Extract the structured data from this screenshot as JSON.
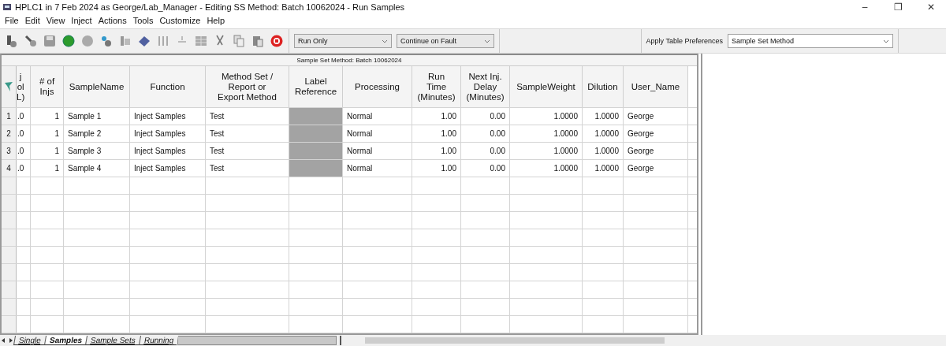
{
  "window": {
    "title": "HPLC1 in 7 Feb 2024 as George/Lab_Manager - Editing SS Method: Batch 10062024 - Run Samples",
    "controls": [
      "–",
      "❐",
      "✕"
    ]
  },
  "menu": [
    "File",
    "Edit",
    "View",
    "Inject",
    "Actions",
    "Tools",
    "Customize",
    "Help"
  ],
  "toolbar": {
    "run_mode": "Run Only",
    "fault_mode": "Continue on Fault",
    "preferences_label": "Apply Table Preferences",
    "preferences_value": "Sample Set Method"
  },
  "table": {
    "caption": "Sample Set Method: Batch 10062024",
    "columns": [
      {
        "label": "j\nol\nL)",
        "kind": "text"
      },
      {
        "label": "# of\nInjs",
        "kind": "number"
      },
      {
        "label": "SampleName",
        "kind": "text"
      },
      {
        "label": "Function",
        "kind": "text"
      },
      {
        "label": "Method Set /\nReport or\nExport Method",
        "kind": "text"
      },
      {
        "label": "Label\nReference",
        "kind": "shaded"
      },
      {
        "label": "Processing",
        "kind": "text"
      },
      {
        "label": "Run\nTime\n(Minutes)",
        "kind": "number"
      },
      {
        "label": "Next Inj.\nDelay\n(Minutes)",
        "kind": "number"
      },
      {
        "label": "SampleWeight",
        "kind": "number"
      },
      {
        "label": "Dilution",
        "kind": "number"
      },
      {
        "label": "User_Name",
        "kind": "text"
      }
    ],
    "rows": [
      {
        "number": "1",
        "cells": [
          ".0",
          "1",
          "Sample 1",
          "Inject Samples",
          "Test",
          "",
          "Normal",
          "1.00",
          "0.00",
          "1.0000",
          "1.0000",
          "George"
        ]
      },
      {
        "number": "2",
        "cells": [
          ".0",
          "1",
          "Sample 2",
          "Inject Samples",
          "Test",
          "",
          "Normal",
          "1.00",
          "0.00",
          "1.0000",
          "1.0000",
          "George"
        ]
      },
      {
        "number": "3",
        "cells": [
          ".0",
          "1",
          "Sample 3",
          "Inject Samples",
          "Test",
          "",
          "Normal",
          "1.00",
          "0.00",
          "1.0000",
          "1.0000",
          "George"
        ]
      },
      {
        "number": "4",
        "cells": [
          ".0",
          "1",
          "Sample 4",
          "Inject Samples",
          "Test",
          "",
          "Normal",
          "1.00",
          "0.00",
          "1.0000",
          "1.0000",
          "George"
        ]
      }
    ]
  },
  "sheet_tabs": [
    {
      "label": "Single",
      "selected": false
    },
    {
      "label": "Samples",
      "selected": true
    },
    {
      "label": "Sample Sets",
      "selected": false
    },
    {
      "label": "Running",
      "selected": false
    }
  ]
}
